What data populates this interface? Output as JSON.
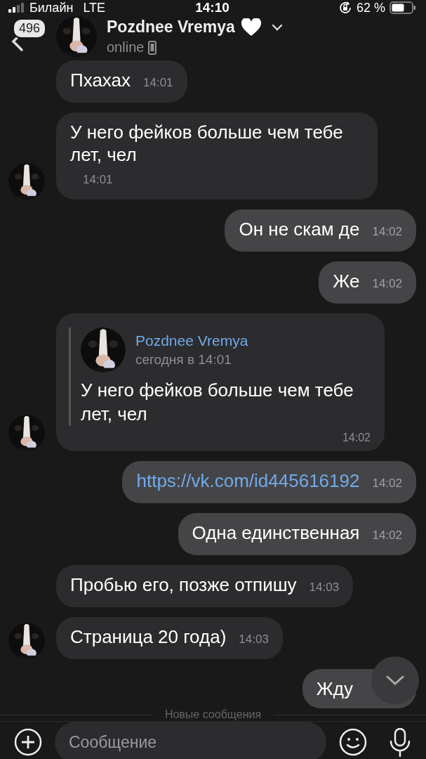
{
  "status_bar": {
    "carrier": "Билайн",
    "network": "LTE",
    "time": "14:10",
    "battery": "62 %"
  },
  "header": {
    "unread_count": "496",
    "name": "Pozdnee Vremya",
    "status": "online"
  },
  "messages": [
    {
      "kind": "text",
      "outgoing": false,
      "avatar": false,
      "text": "Пхахах",
      "time": "14:01"
    },
    {
      "kind": "text",
      "outgoing": false,
      "avatar": true,
      "text": "У него фейков больше чем тебе лет, чел",
      "time": "14:01"
    },
    {
      "kind": "text",
      "outgoing": true,
      "text": "Он не скам де",
      "time": "14:02"
    },
    {
      "kind": "text",
      "outgoing": true,
      "text": "Же",
      "time": "14:02"
    },
    {
      "kind": "quote",
      "outgoing": false,
      "avatar": true,
      "quote": {
        "author": "Pozdnee Vremya",
        "date": "сегодня в 14:01",
        "text": "У него фейков больше чем тебе лет, чел"
      },
      "time": "14:02"
    },
    {
      "kind": "link",
      "outgoing": true,
      "text": "https://vk.com/id445616192",
      "time": "14:02"
    },
    {
      "kind": "text",
      "outgoing": true,
      "text": "Одна единственная",
      "time": "14:02"
    },
    {
      "kind": "text",
      "outgoing": false,
      "avatar": false,
      "text": "Пробью его, позже отпишу",
      "time": "14:03"
    },
    {
      "kind": "text",
      "outgoing": false,
      "avatar": true,
      "text": "Страница 20 года)",
      "time": "14:03"
    },
    {
      "kind": "text",
      "outgoing": true,
      "text": "Жду"
    }
  ],
  "divider": "Новые сообщения",
  "composer": {
    "placeholder": "Сообщение"
  }
}
